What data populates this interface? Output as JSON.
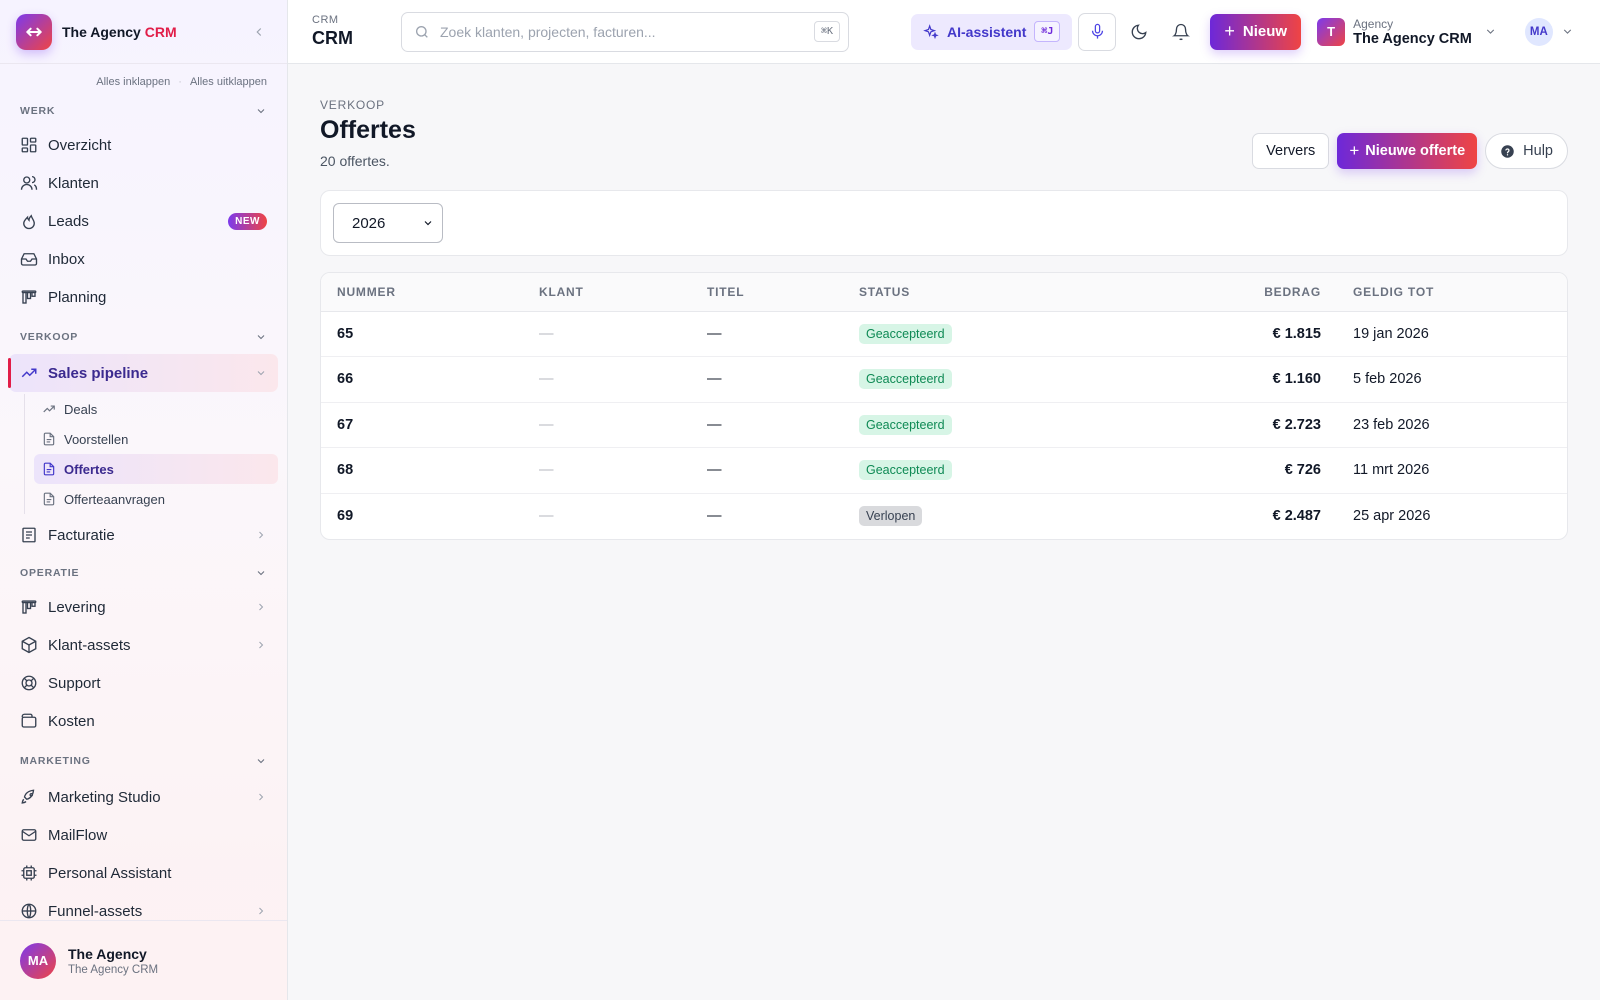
{
  "brand": {
    "name_main": "The Agency ",
    "name_accent": "CRM"
  },
  "sidebar": {
    "collapse_all": "Alles inklappen",
    "expand_all": "Alles uitklappen",
    "separator": "·",
    "sections": {
      "werk": "WERK",
      "verkoop": "VERKOOP",
      "operatie": "OPERATIE",
      "marketing": "MARKETING"
    },
    "items": {
      "overzicht": "Overzicht",
      "klanten": "Klanten",
      "leads": "Leads",
      "leads_badge": "NEW",
      "inbox": "Inbox",
      "planning": "Planning",
      "sales_pipeline": "Sales pipeline",
      "deals": "Deals",
      "voorstellen": "Voorstellen",
      "offertes": "Offertes",
      "offerteaanvragen": "Offerteaanvragen",
      "facturatie": "Facturatie",
      "levering": "Levering",
      "klant_assets": "Klant-assets",
      "support": "Support",
      "kosten": "Kosten",
      "marketing_studio": "Marketing Studio",
      "mailflow": "MailFlow",
      "personal_assistant": "Personal Assistant",
      "funnel_assets": "Funnel-assets"
    },
    "footer": {
      "initials": "MA",
      "name": "The Agency",
      "sub": "The Agency CRM"
    }
  },
  "topbar": {
    "crumb_small": "CRM",
    "crumb_big": "CRM",
    "search_placeholder": "Zoek klanten, projecten, facturen...",
    "search_kbd": "⌘K",
    "ai_label": "AI-assistent",
    "ai_kbd": "⌘J",
    "new_label": "Nieuw",
    "org_small": "Agency",
    "org_big": "The Agency CRM",
    "org_initial": "T",
    "user_initials": "MA"
  },
  "page": {
    "kicker": "VERKOOP",
    "title": "Offertes",
    "subtitle": "20 offertes.",
    "refresh": "Ververs",
    "new_quote": "Nieuwe offerte",
    "help": "Hulp",
    "year": "2026"
  },
  "table": {
    "headers": {
      "nummer": "NUMMER",
      "klant": "KLANT",
      "titel": "TITEL",
      "status": "STATUS",
      "bedrag": "BEDRAG",
      "geldig_tot": "GELDIG TOT"
    },
    "rows": [
      {
        "nummer": "65",
        "klant": "—",
        "titel": "—",
        "status": "Geaccepteerd",
        "bedrag": "€ 1.815",
        "geldig_tot": "19 jan 2026"
      },
      {
        "nummer": "66",
        "klant": "—",
        "titel": "—",
        "status": "Geaccepteerd",
        "bedrag": "€ 1.160",
        "geldig_tot": "5 feb 2026"
      },
      {
        "nummer": "67",
        "klant": "—",
        "titel": "—",
        "status": "Geaccepteerd",
        "bedrag": "€ 2.723",
        "geldig_tot": "23 feb 2026"
      },
      {
        "nummer": "68",
        "klant": "—",
        "titel": "—",
        "status": "Geaccepteerd",
        "bedrag": "€ 726",
        "geldig_tot": "11 mrt 2026"
      },
      {
        "nummer": "69",
        "klant": "—",
        "titel": "—",
        "status": "Verlopen",
        "bedrag": "€ 2.487",
        "geldig_tot": "25 apr 2026"
      }
    ]
  },
  "colors": {
    "accent": "#6d28d9",
    "brand_red": "#e11d48",
    "status_accepted_bg": "#d7f5e6",
    "status_accepted_text": "#0f8a55",
    "status_expired_bg": "#d9dadd"
  }
}
